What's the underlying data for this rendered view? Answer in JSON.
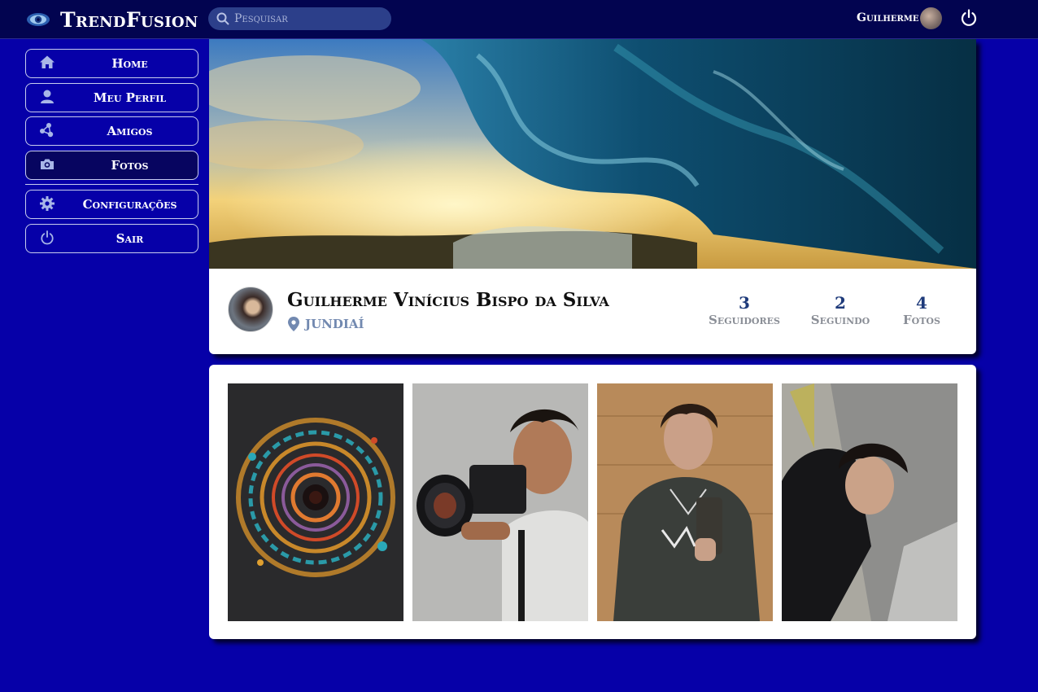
{
  "app": {
    "name": "TrendFusion"
  },
  "search": {
    "placeholder": "Pesquisar"
  },
  "header_user": {
    "name": "Guilherme"
  },
  "sidebar": {
    "items": [
      {
        "label": "Home",
        "icon": "home-icon"
      },
      {
        "label": "Meu Perfil",
        "icon": "user-icon"
      },
      {
        "label": "Amigos",
        "icon": "friends-icon"
      },
      {
        "label": "Fotos",
        "icon": "camera-icon"
      },
      {
        "label": "Configurações",
        "icon": "gear-icon"
      },
      {
        "label": "Sair",
        "icon": "power-icon"
      }
    ],
    "active": "Fotos"
  },
  "profile": {
    "name": "Guilherme Vinícius Bispo da Silva",
    "location": "JUNDIAÍ",
    "stats": [
      {
        "value": "3",
        "label": "Seguidores"
      },
      {
        "value": "2",
        "label": "Seguindo"
      },
      {
        "value": "4",
        "label": "Fotos"
      }
    ]
  },
  "photos": [
    {
      "subject": "abstract-spiral-art"
    },
    {
      "subject": "man-with-camera"
    },
    {
      "subject": "mirror-selfie"
    },
    {
      "subject": "portrait"
    }
  ],
  "colors": {
    "background": "#0600a8",
    "topbar": "#020450",
    "accent": "#1e3a7a"
  }
}
